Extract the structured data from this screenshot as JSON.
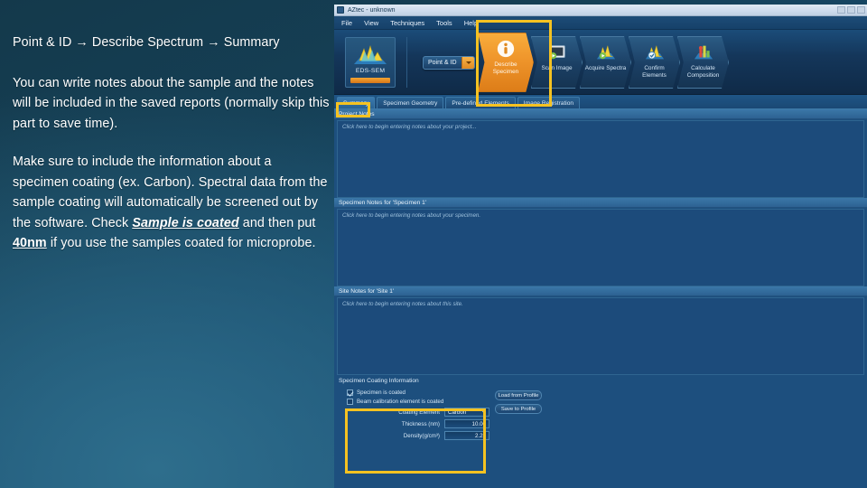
{
  "slide": {
    "heading": "Point & ID → Describe Spectrum → Summary",
    "paragraph1": "You can write notes about the sample and the notes will be included in the saved reports (normally skip this part to save time).",
    "paragraph2_a": "Make sure to include the information about a specimen coating (ex. Carbon). Spectral data from the sample coating will automatically be screened out by the software.  Check ",
    "paragraph2_em1": "Sample is coated",
    "paragraph2_b": " and then put ",
    "paragraph2_em2": "40nm",
    "paragraph2_c": " if you use the samples coated for microprobe.",
    "accent_highlight": "#f5c221"
  },
  "app": {
    "title": "AZtec - unknown",
    "menu": [
      "File",
      "View",
      "Techniques",
      "Tools",
      "Help"
    ],
    "logo": {
      "label": "EDS-SEM"
    },
    "mode_button": "Point & ID",
    "steps": [
      {
        "label": "Describe Specimen",
        "icon": "info-icon",
        "active": true
      },
      {
        "label": "Scan Image",
        "icon": "image-icon",
        "active": false
      },
      {
        "label": "Acquire Spectra",
        "icon": "spectrum-play-icon",
        "active": false
      },
      {
        "label": "Confirm Elements",
        "icon": "spectrum-check-icon",
        "active": false
      },
      {
        "label": "Calculate Composition",
        "icon": "composition-icon",
        "active": false
      }
    ],
    "tabs": [
      {
        "label": "Summary",
        "selected": true
      },
      {
        "label": "Specimen Geometry",
        "selected": false
      },
      {
        "label": "Pre-defined Elements",
        "selected": false
      },
      {
        "label": "Image Registration",
        "selected": false
      }
    ],
    "panels": [
      {
        "title": "Project Notes",
        "placeholder": "Click here to begin entering notes about your project..."
      },
      {
        "title": "Specimen Notes for 'Specimen 1'",
        "placeholder": "Click here to begin entering notes about your specimen."
      },
      {
        "title": "Site Notes for 'Site 1'",
        "placeholder": "Click here to begin entering notes about this site."
      }
    ],
    "coating": {
      "title": "Specimen Coating Information",
      "checkbox_specimen": "Specimen is coated",
      "checkbox_specimen_checked": true,
      "checkbox_beam": "Beam calibration element is coated",
      "checkbox_beam_checked": false,
      "element_label": "Coating Element",
      "element_value": "Carbon",
      "thickness_label": "Thickness (nm)",
      "thickness_value": "10.00",
      "density_label": "Density(g/cm³)",
      "density_value": "2.25",
      "load_profile": "Load from Profile",
      "save_profile": "Save to Profile"
    }
  }
}
